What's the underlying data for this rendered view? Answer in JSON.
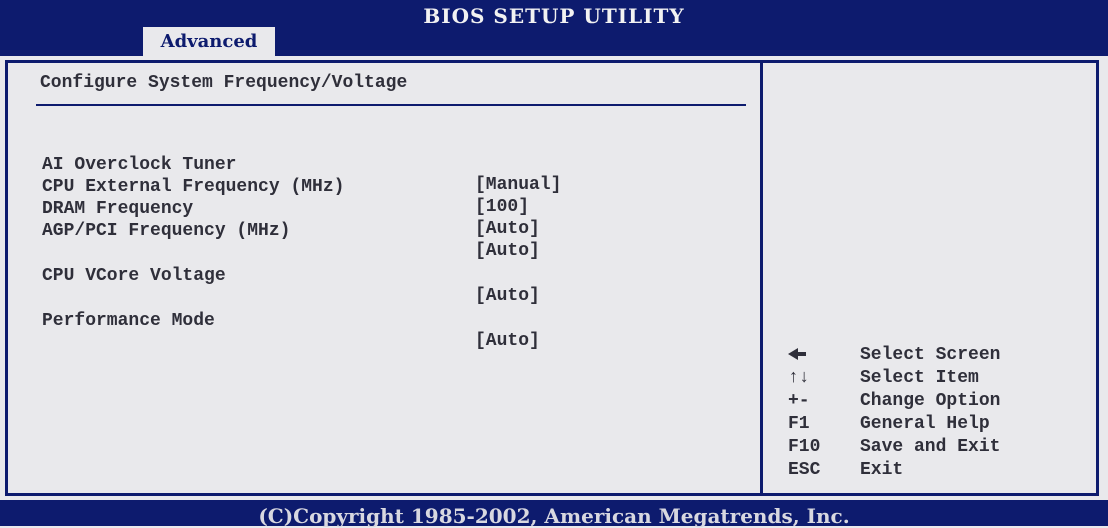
{
  "header": {
    "title": "BIOS SETUP UTILITY",
    "active_tab": "Advanced"
  },
  "section": {
    "title": "Configure System Frequency/Voltage"
  },
  "settings": [
    {
      "label": "AI Overclock Tuner",
      "value": "[Manual]"
    },
    {
      "label": "CPU External Frequency (MHz)",
      "value": "[100]"
    },
    {
      "label": "DRAM Frequency",
      "value": "[Auto]"
    },
    {
      "label": "AGP/PCI Frequency (MHz)",
      "value": "[Auto]"
    },
    {
      "label": "CPU VCore Voltage",
      "value": "[Auto]"
    },
    {
      "label": "Performance Mode",
      "value": "[Auto]"
    }
  ],
  "help": [
    {
      "key": "←",
      "desc": "Select Screen",
      "icon": "arrow-left-icon"
    },
    {
      "key": "↑↓",
      "desc": "Select Item",
      "icon": "arrow-updown-icon"
    },
    {
      "key": "+-",
      "desc": "Change Option"
    },
    {
      "key": "F1",
      "desc": "General Help"
    },
    {
      "key": "F10",
      "desc": "Save and Exit"
    },
    {
      "key": "ESC",
      "desc": "Exit"
    }
  ],
  "footer": {
    "copyright": "(C)Copyright 1985-2002, American Megatrends, Inc."
  },
  "colors": {
    "bar": "#0d1b6e",
    "background": "#e9e9ec",
    "text": "#2f2f3a"
  }
}
